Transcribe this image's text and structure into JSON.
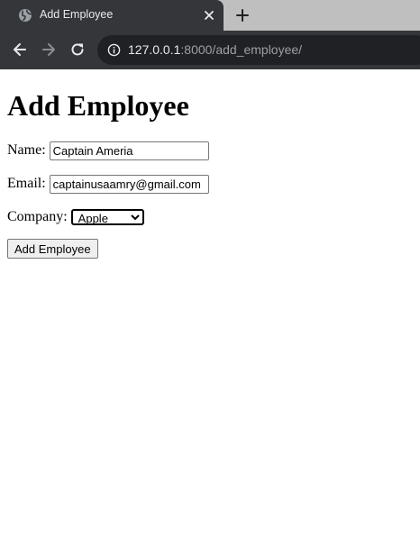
{
  "browser": {
    "tab": {
      "title": "Add Employee",
      "favicon": "globe-icon",
      "close_icon": "close-icon"
    },
    "new_tab_icon": "plus-icon",
    "toolbar": {
      "back_icon": "arrow-left-icon",
      "forward_icon": "arrow-right-icon",
      "reload_icon": "reload-icon",
      "site_info_icon": "info-icon"
    },
    "url": {
      "host": "127.0.0.1",
      "rest": ":8000/add_employee/"
    },
    "colors": {
      "frame": "#202124",
      "toolbar": "#35363a",
      "tabstrip": "#bfbfbf",
      "url_host": "#e8eaed",
      "url_rest": "#9aa0a6"
    }
  },
  "page": {
    "heading": "Add Employee",
    "form": {
      "name_label": "Name:",
      "name_value": "Captain Ameria",
      "email_label": "Email:",
      "email_value": "captainusaamry@gmail.com",
      "company_label": "Company:",
      "company_selected": "Apple",
      "submit_label": "Add Employee"
    }
  }
}
